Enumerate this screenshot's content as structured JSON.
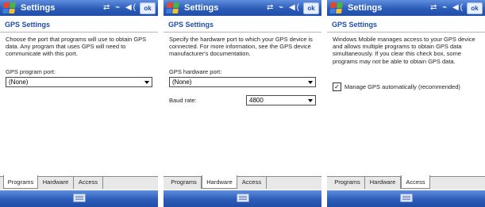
{
  "screens": [
    {
      "app_title": "Settings",
      "status_icons": "⇄ ⌁ ◀(",
      "ok_label": "ok",
      "heading": "GPS Settings",
      "description": "Choose the port that programs will use to obtain GPS data. Any program that uses GPS will need to communicate with this port.",
      "port_label": "GPS program port:",
      "port_value": "(None)",
      "tabs": [
        "Programs",
        "Hardware",
        "Access"
      ],
      "active_tab": "Programs"
    },
    {
      "app_title": "Settings",
      "status_icons": "⇄ ⌁ ◀(",
      "ok_label": "ok",
      "heading": "GPS Settings",
      "description": "Specify the hardware port to which your GPS device is connected. For more information, see the GPS device manufacturer's documentation.",
      "port_label": "GPS hardware port:",
      "port_value": "(None)",
      "baud_label": "Baud rate:",
      "baud_value": "4800",
      "tabs": [
        "Programs",
        "Hardware",
        "Access"
      ],
      "active_tab": "Hardware"
    },
    {
      "app_title": "Settings",
      "status_icons": "⇄ ⌁ ◀(",
      "ok_label": "ok",
      "heading": "GPS Settings",
      "description": "Windows Mobile manages access to your GPS device and allows multiple programs to obtain GPS data simultaneously. If you clear this check box, some programs may not be able to obtain GPS data.",
      "checkbox_label": "Manage GPS automatically (recommended)",
      "checkbox_checked": true,
      "checkbox_mark": "✓",
      "tabs": [
        "Programs",
        "Hardware",
        "Access"
      ],
      "active_tab": "Access"
    }
  ],
  "colors": {
    "titlebar": "#2c5cb8",
    "heading": "#1f4ea8",
    "tabbar": "#e8e8e8"
  },
  "icons": {
    "start": "windows-flag-icon",
    "connectivity": "connectivity-icon",
    "signal": "signal-icon",
    "volume": "volume-icon",
    "keyboard": "keyboard-icon"
  }
}
